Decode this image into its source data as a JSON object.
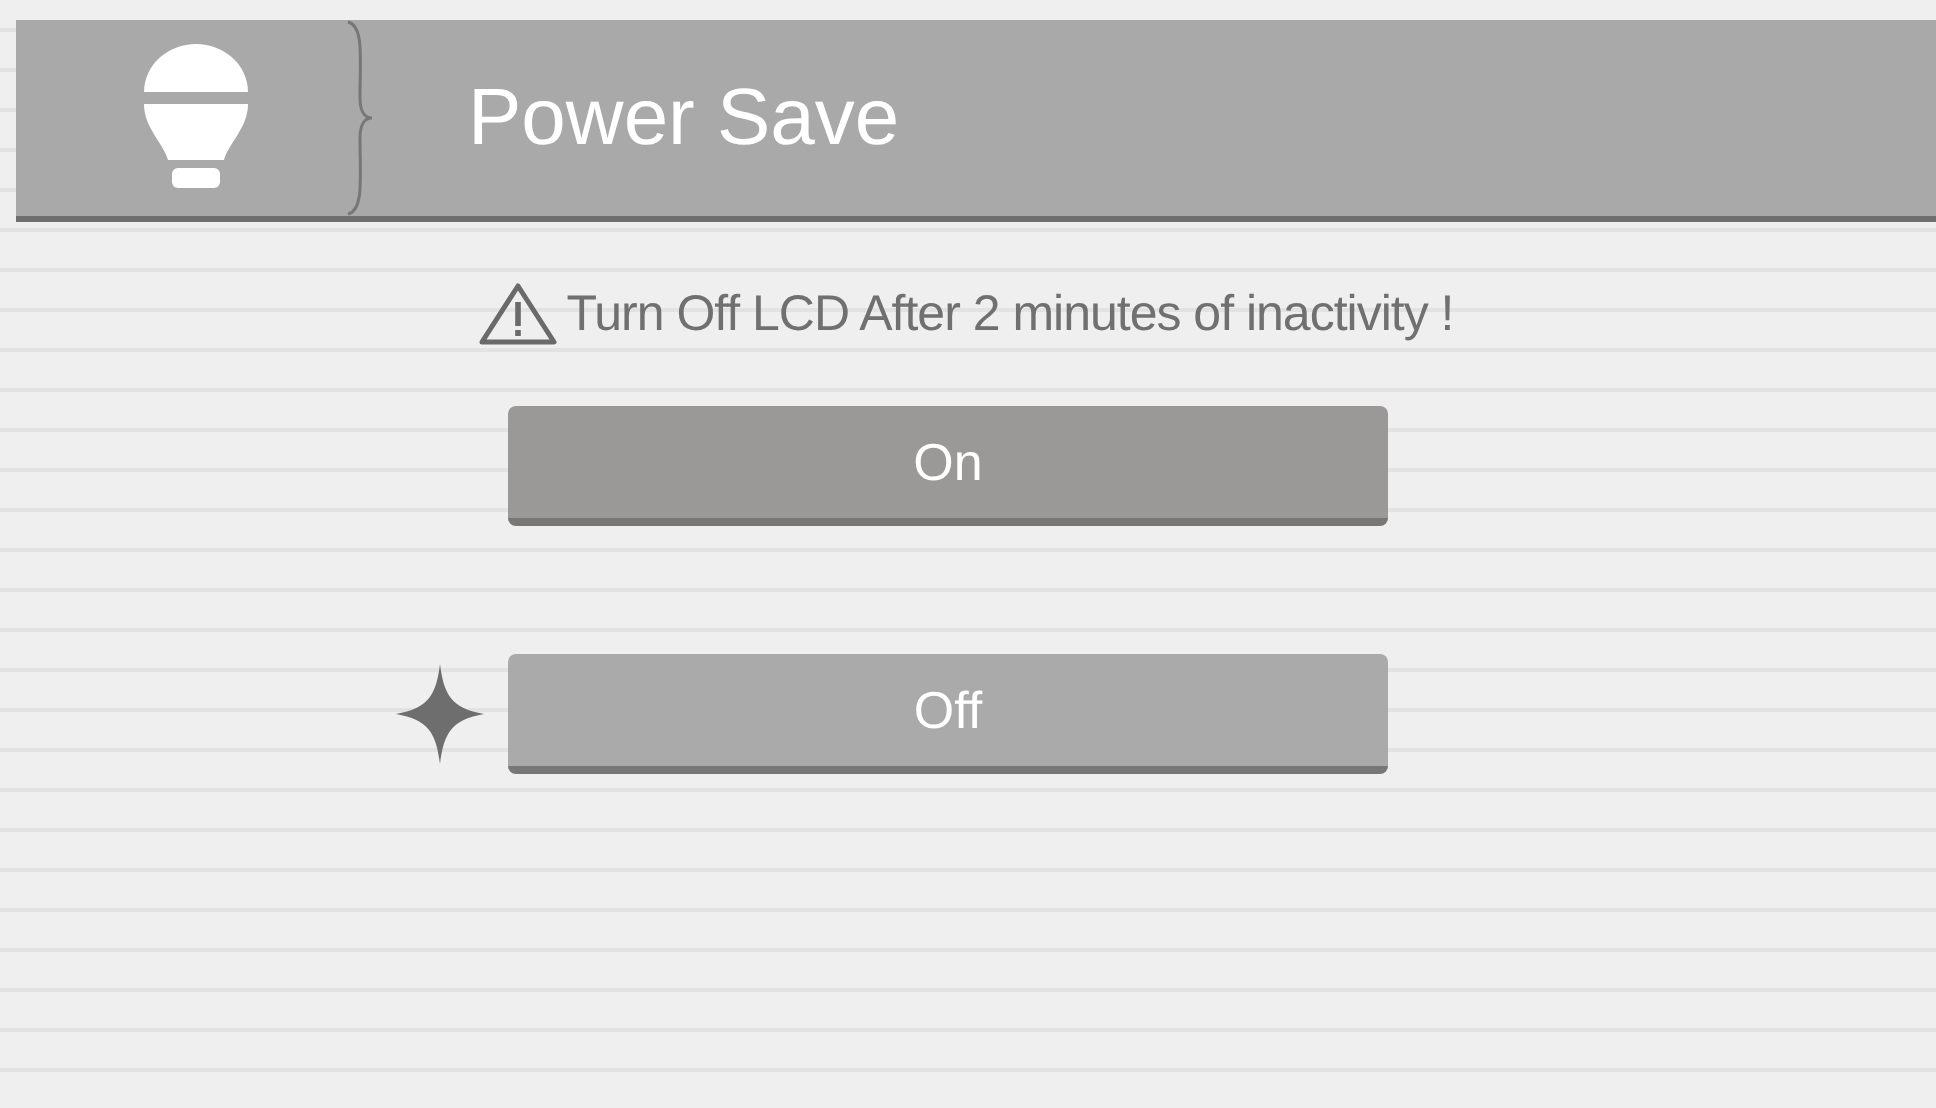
{
  "header": {
    "title": "Power Save"
  },
  "notice": {
    "text": "Turn Off LCD After 2 minutes of inactivity !"
  },
  "options": [
    {
      "label": "On",
      "selected": false
    },
    {
      "label": "Off",
      "selected": true
    }
  ]
}
